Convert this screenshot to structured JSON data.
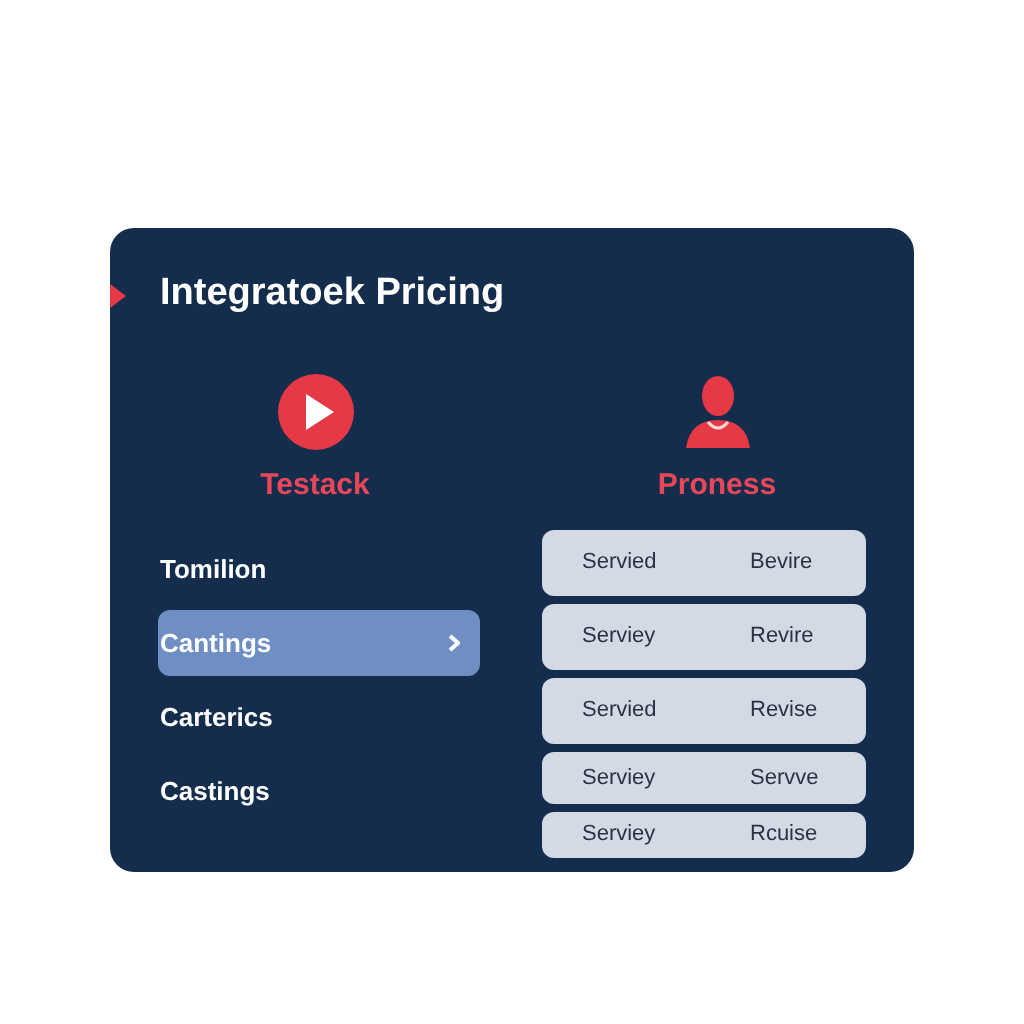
{
  "card": {
    "title": "Integratoek Pricing",
    "columns": [
      {
        "kind": "play",
        "label": "Testack"
      },
      {
        "kind": "person",
        "label": "Proness"
      }
    ],
    "menu": [
      {
        "label": "Tomilion",
        "selected": false
      },
      {
        "label": "Cantings",
        "selected": true
      },
      {
        "label": "Carterics",
        "selected": false
      },
      {
        "label": "Castings",
        "selected": false
      }
    ],
    "rows": [
      {
        "column_1": "Servied",
        "column_2": "Bevire"
      },
      {
        "column_1": "Serviey",
        "column_2": "Revire"
      },
      {
        "column_1": "Servied",
        "column_2": "Revise"
      },
      {
        "column_1": "Serviey",
        "column_2": "Servve"
      },
      {
        "column_1": "Serviey",
        "column_2": "Rcuise"
      }
    ]
  }
}
